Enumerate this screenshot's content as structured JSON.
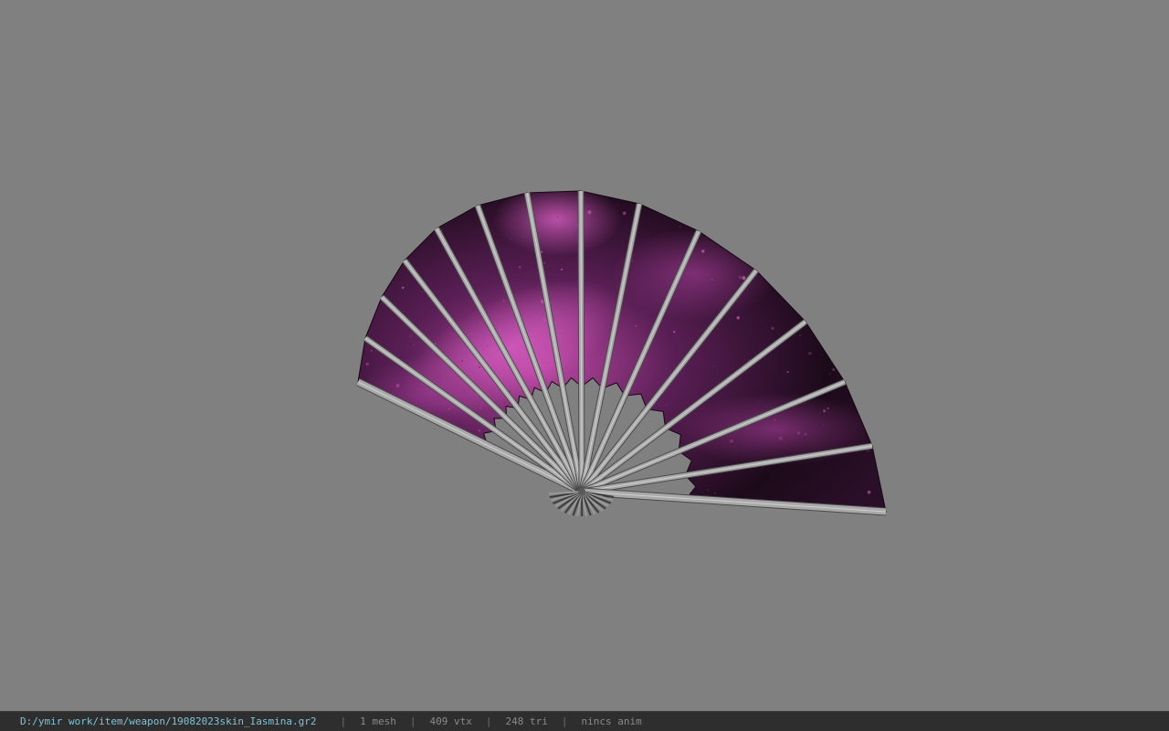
{
  "viewport": {
    "background": "#808080",
    "model": {
      "name": "fan-weapon-model",
      "fabric_colors": [
        "#1c0a1a",
        "#5a1f55",
        "#c04aa8"
      ],
      "rib_color": "#a9a9a9"
    }
  },
  "status": {
    "file_path": "D:/ymir work/item/weapon/19082023skin_Iasmina.gr2",
    "separator": "|",
    "mesh_count": "1 mesh",
    "vertex_count": "409 vtx",
    "triangle_count": "248 tri",
    "anim_status": "nincs anim"
  }
}
